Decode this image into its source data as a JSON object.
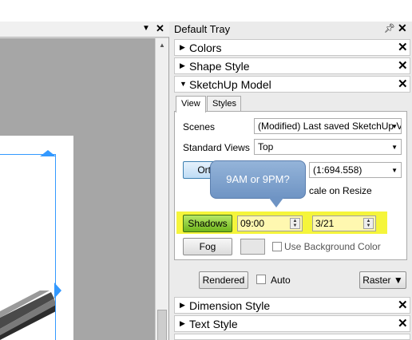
{
  "tray": {
    "title": "Default Tray",
    "pin_icon": "pin-icon",
    "close_icon": "close-icon"
  },
  "panels": {
    "colors": "Colors",
    "shape_style": "Shape Style",
    "sketchup_model": "SketchUp Model",
    "dimension_style": "Dimension Style",
    "text_style": "Text Style"
  },
  "tabs": [
    "View",
    "Styles"
  ],
  "view": {
    "scenes_label": "Scenes",
    "scenes_value": "(Modified) Last saved SketchUp Vi",
    "standard_views_label": "Standard Views",
    "standard_views_value": "Top",
    "ortho_label": "Orth",
    "scale_value": "(1:694.558)",
    "scale_on_resize": "cale on Resize",
    "shadows_label": "Shadows",
    "time_value": "09:00",
    "date_value": "3/21",
    "fog_label": "Fog",
    "use_bg_label": "Use Background Color",
    "rendered_label": "Rendered",
    "auto_label": "Auto",
    "raster_label": "Raster"
  },
  "tooltip": {
    "text": "9AM or 9PM?"
  },
  "colors": {
    "highlight": "#f5f53b",
    "shadows_button": "#7ec22a",
    "tooltip": "#7c9ecb",
    "selection": "#3399ff"
  }
}
